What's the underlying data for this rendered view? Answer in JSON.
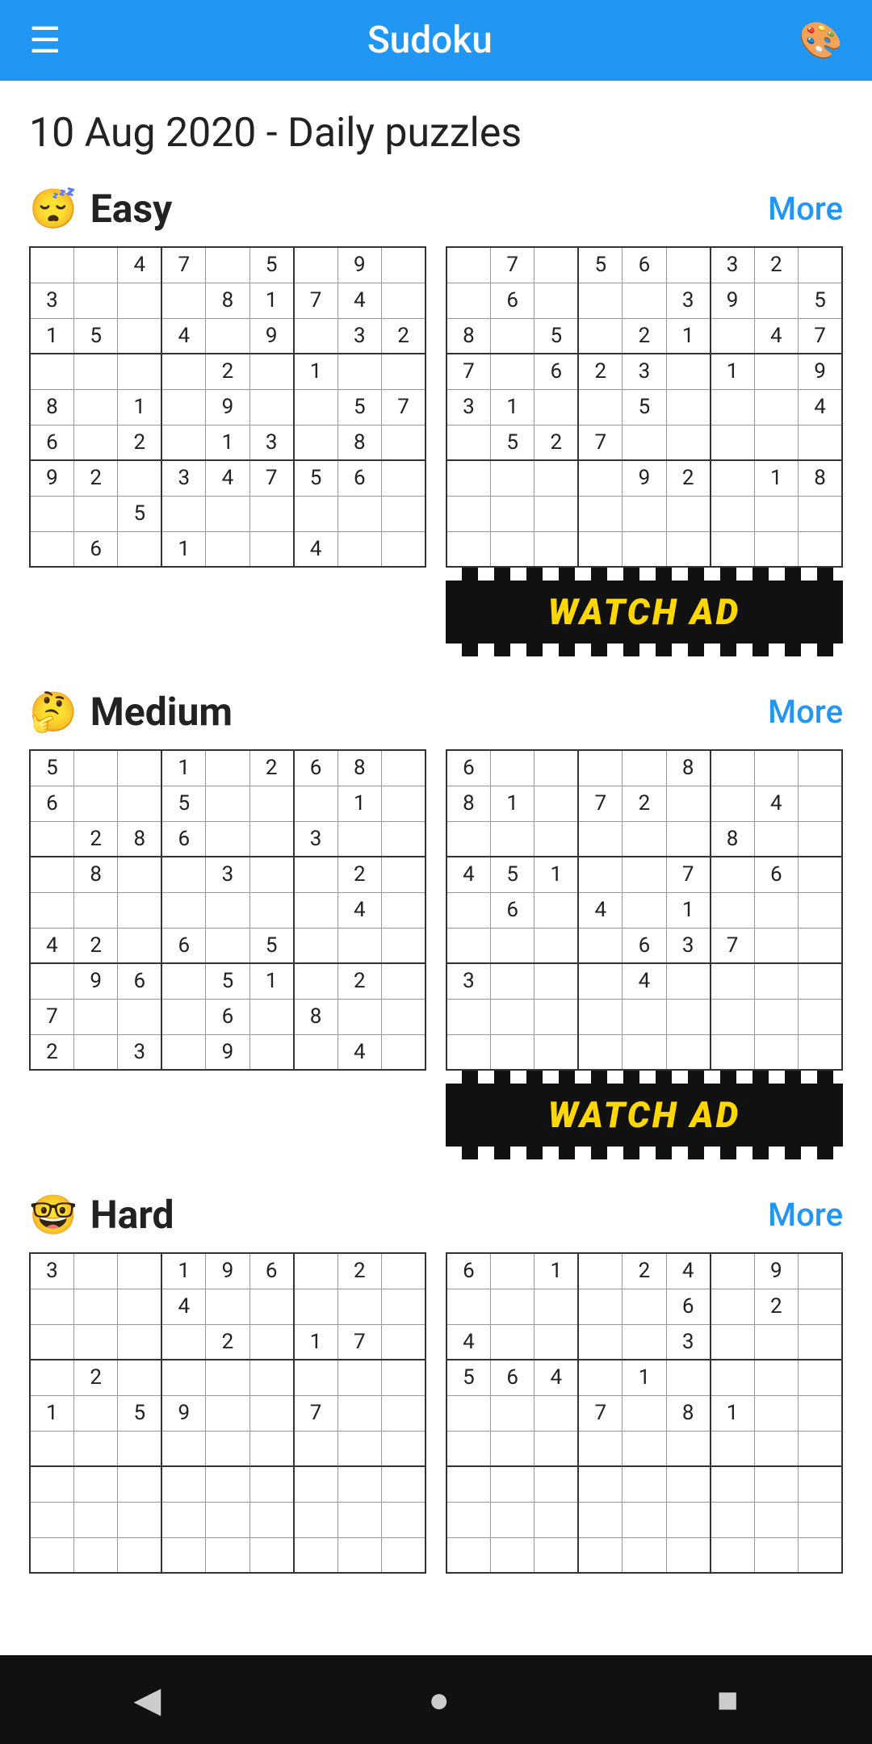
{
  "topbar": {
    "title": "Sudoku",
    "menu_icon": "☰",
    "palette_icon": "🎨"
  },
  "page_title": "10 Aug 2020 - Daily puzzles",
  "sections": [
    {
      "id": "easy",
      "emoji": "😴",
      "title": "Easy",
      "more_label": "More",
      "puzzle_left": [
        [
          "",
          "",
          "4",
          "7",
          "",
          "5",
          "",
          "9",
          ""
        ],
        [
          "3",
          "",
          "",
          "",
          "8",
          "1",
          "7",
          "4",
          ""
        ],
        [
          "1",
          "5",
          "",
          "4",
          "",
          "9",
          "",
          "3",
          "2"
        ],
        [
          "",
          "",
          "",
          "",
          "2",
          "",
          "1",
          "",
          ""
        ],
        [
          "8",
          "",
          "1",
          "",
          "9",
          "",
          "",
          "5",
          "7"
        ],
        [
          "6",
          "",
          "2",
          "",
          "1",
          "3",
          "",
          "8",
          ""
        ],
        [
          "9",
          "2",
          "",
          "3",
          "4",
          "7",
          "5",
          "6",
          ""
        ],
        [
          "",
          "",
          "5",
          "",
          "",
          "",
          "",
          "",
          ""
        ],
        [
          "",
          "6",
          "",
          "1",
          "",
          "",
          "4",
          "",
          ""
        ]
      ],
      "puzzle_right": [
        [
          "",
          "7",
          "",
          "5",
          "6",
          "",
          "3",
          "2",
          ""
        ],
        [
          "",
          "6",
          "",
          "",
          "",
          "3",
          "9",
          "",
          "5"
        ],
        [
          "8",
          "",
          "5",
          "",
          "2",
          "1",
          "",
          "4",
          "7"
        ],
        [
          "7",
          "",
          "6",
          "2",
          "3",
          "",
          "1",
          "",
          "9"
        ],
        [
          "3",
          "1",
          "",
          "",
          "5",
          "",
          "",
          "",
          "4"
        ],
        [
          "",
          "5",
          "2",
          "7",
          "",
          "",
          "",
          "",
          ""
        ],
        [
          "",
          "",
          "",
          "",
          "9",
          "2",
          "",
          "1",
          "8"
        ],
        [
          "",
          "",
          "",
          "",
          "",
          "",
          "",
          "",
          ""
        ],
        [
          "",
          "",
          "",
          "",
          "",
          "",
          "",
          "",
          ""
        ]
      ],
      "right_has_ad": true
    },
    {
      "id": "medium",
      "emoji": "🤔",
      "title": "Medium",
      "more_label": "More",
      "puzzle_left": [
        [
          "5",
          "",
          "",
          "1",
          "",
          "2",
          "6",
          "8",
          ""
        ],
        [
          "6",
          "",
          "",
          "5",
          "",
          "",
          "",
          "1",
          ""
        ],
        [
          "",
          "2",
          "8",
          "6",
          "",
          "",
          "3",
          "",
          ""
        ],
        [
          "",
          "8",
          "",
          "",
          "3",
          "",
          "",
          "2",
          ""
        ],
        [
          "",
          "",
          "",
          "",
          "",
          "",
          "",
          "4",
          ""
        ],
        [
          "4",
          "2",
          "",
          "6",
          "",
          "5",
          "",
          "",
          ""
        ],
        [
          "",
          "9",
          "6",
          "",
          "5",
          "1",
          "",
          "2",
          ""
        ],
        [
          "7",
          "",
          "",
          "",
          "6",
          "",
          "8",
          "",
          ""
        ],
        [
          "2",
          "",
          "3",
          "",
          "9",
          "",
          "",
          "4",
          ""
        ]
      ],
      "puzzle_right": [
        [
          "6",
          "",
          "",
          "",
          "",
          "8",
          "",
          "",
          ""
        ],
        [
          "8",
          "1",
          "",
          "7",
          "2",
          "",
          "",
          "4",
          ""
        ],
        [
          "",
          "",
          "",
          "",
          "",
          "",
          "8",
          "",
          ""
        ],
        [
          "4",
          "5",
          "1",
          "",
          "",
          "7",
          "",
          "6",
          ""
        ],
        [
          "",
          "6",
          "",
          "4",
          "",
          "1",
          "",
          "",
          ""
        ],
        [
          "",
          "",
          "",
          "",
          "6",
          "3",
          "7",
          "",
          ""
        ],
        [
          "3",
          "",
          "",
          "",
          "4",
          "",
          "",
          "",
          ""
        ],
        [
          "",
          "",
          "",
          "",
          "",
          "",
          "",
          "",
          ""
        ],
        [
          "",
          "",
          "",
          "",
          "",
          "",
          "",
          "",
          ""
        ]
      ],
      "right_has_ad": true
    },
    {
      "id": "hard",
      "emoji": "🤓",
      "title": "Hard",
      "more_label": "More",
      "puzzle_left": [
        [
          "3",
          "",
          "",
          "1",
          "9",
          "6",
          "",
          "2",
          ""
        ],
        [
          "",
          "",
          "",
          "4",
          "",
          "",
          "",
          "",
          ""
        ],
        [
          "",
          "",
          "",
          "",
          "2",
          "",
          "1",
          "7",
          ""
        ],
        [
          "",
          "2",
          "",
          "",
          "",
          "",
          "",
          "",
          ""
        ],
        [
          "1",
          "",
          "5",
          "9",
          "",
          "",
          "7",
          "",
          ""
        ],
        [
          "",
          "",
          "",
          "",
          "",
          "",
          "",
          "",
          ""
        ],
        [
          "",
          "",
          "",
          "",
          "",
          "",
          "",
          "",
          ""
        ],
        [
          "",
          "",
          "",
          "",
          "",
          "",
          "",
          "",
          ""
        ],
        [
          "",
          "",
          "",
          "",
          "",
          "",
          "",
          "",
          ""
        ]
      ],
      "puzzle_right": [
        [
          "6",
          "",
          "1",
          "",
          "2",
          "4",
          "",
          "9",
          ""
        ],
        [
          "",
          "",
          "",
          "",
          "",
          "6",
          "",
          "2",
          ""
        ],
        [
          "4",
          "",
          "",
          "",
          "",
          "3",
          "",
          "",
          ""
        ],
        [
          "5",
          "6",
          "4",
          "",
          "1",
          "",
          "",
          "",
          ""
        ],
        [
          "",
          "",
          "",
          "7",
          "",
          "8",
          "1",
          "",
          ""
        ],
        [
          "",
          "",
          "",
          "",
          "",
          "",
          "",
          "",
          ""
        ],
        [
          "",
          "",
          "",
          "",
          "",
          "",
          "",
          "",
          ""
        ],
        [
          "",
          "",
          "",
          "",
          "",
          "",
          "",
          "",
          ""
        ],
        [
          "",
          "",
          "",
          "",
          "",
          "",
          "",
          "",
          ""
        ]
      ],
      "right_has_ad": false
    }
  ],
  "navbar": {
    "back_icon": "◀",
    "home_icon": "●",
    "square_icon": "■"
  },
  "watch_ad_label": "WATCH AD"
}
